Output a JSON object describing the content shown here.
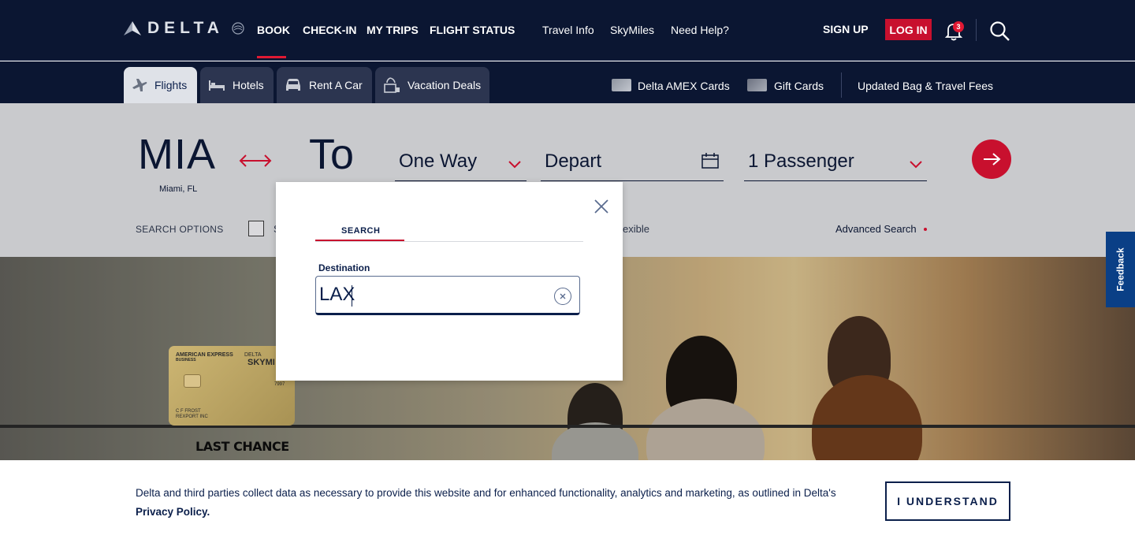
{
  "brand": {
    "name": "DELTA"
  },
  "nav": {
    "main": [
      "BOOK",
      "CHECK-IN",
      "MY TRIPS",
      "FLIGHT STATUS"
    ],
    "secondary": [
      "Travel Info",
      "SkyMiles",
      "Need Help?"
    ],
    "sign_up": "SIGN UP",
    "log_in": "LOG IN",
    "notification_count": "3"
  },
  "subnav": {
    "tabs": [
      "Flights",
      "Hotels",
      "Rent A Car",
      "Vacation Deals"
    ],
    "links": [
      "Delta AMEX Cards",
      "Gift Cards",
      "Updated Bag & Travel Fees"
    ]
  },
  "booking": {
    "origin_code": "MIA",
    "origin_city": "Miami, FL",
    "destination_placeholder": "To",
    "trip_type": "One Way",
    "depart": "Depart",
    "passengers": "1 Passenger",
    "search_options": "SEARCH OPTIONS",
    "option_partial": "S",
    "flexible_partial": "exible",
    "advanced_search": "Advanced Search"
  },
  "hero": {
    "card_issuer": "AMERICAN EXPRESS",
    "card_sub": "BUSINESS",
    "card_brand": "DELTA",
    "card_program": "SKYMI",
    "card_name": "C F FROST",
    "card_company": "REXPORT INC",
    "card_number": "7997",
    "promo": "LAST CHANCE"
  },
  "modal": {
    "tab": "SEARCH",
    "label": "Destination",
    "value": "LAX"
  },
  "cookie": {
    "text": "Delta and third parties collect data as necessary to provide this website and for enhanced functionality, analytics and marketing, as outlined in Delta's ",
    "link": "Privacy Policy.",
    "button": "I UNDERSTAND"
  },
  "feedback": {
    "label": "Feedback"
  },
  "colors": {
    "navy": "#0b1632",
    "red": "#c8102e",
    "feedback_blue": "#0a3f86"
  }
}
